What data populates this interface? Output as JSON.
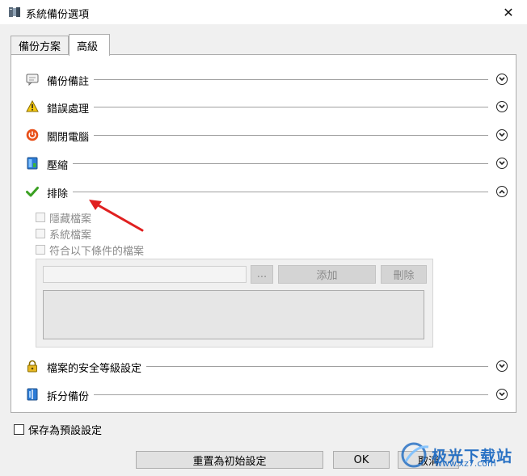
{
  "window": {
    "title": "系統備份選項",
    "close_glyph": "✕"
  },
  "tabs": [
    {
      "label": "備份方案",
      "active": false
    },
    {
      "label": "高級",
      "active": true
    }
  ],
  "sections": {
    "backup_notes": {
      "label": "備份備註",
      "icon": "comment-icon",
      "expanded": false
    },
    "error_handling": {
      "label": "錯誤處理",
      "icon": "warning-icon",
      "expanded": false
    },
    "shutdown": {
      "label": "關閉電腦",
      "icon": "power-icon",
      "expanded": false
    },
    "compression": {
      "label": "壓縮",
      "icon": "compress-icon",
      "expanded": false
    },
    "exclude": {
      "label": "排除",
      "icon": "check-icon",
      "expanded": true
    },
    "security": {
      "label": "檔案的安全等級設定",
      "icon": "lock-icon",
      "expanded": false
    },
    "split_backup": {
      "label": "拆分備份",
      "icon": "split-icon",
      "expanded": false
    }
  },
  "exclude_options": {
    "hidden_files": "隱藏檔案",
    "system_files": "系統檔案",
    "matching_files": "符合以下條件的檔案",
    "pattern_value": "",
    "browse_label": "...",
    "add_label": "添加",
    "delete_label": "刪除"
  },
  "footer": {
    "save_default_label": "保存為預設設定",
    "reset_label": "重置為初始設定",
    "ok_label": "OK",
    "cancel_label": "取消"
  },
  "watermark": {
    "brand": "极光下载站",
    "url": "www.xz7.com"
  },
  "colors": {
    "accent_arrow": "#e02020",
    "power": "#e8501a",
    "check": "#3aa022",
    "watermark": "#1565c0"
  }
}
